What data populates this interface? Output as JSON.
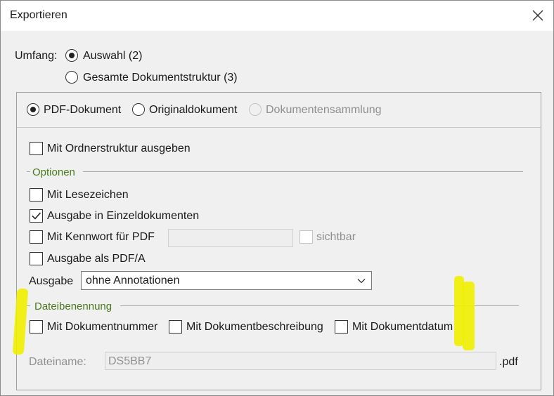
{
  "window": {
    "title": "Exportieren",
    "close_icon": "close-icon"
  },
  "scope": {
    "label": "Umfang:",
    "options": [
      {
        "label": "Auswahl (2)",
        "checked": true
      },
      {
        "label": "Gesamte Dokumentstruktur (3)",
        "checked": false
      }
    ]
  },
  "format": {
    "options": [
      {
        "label": "PDF-Dokument",
        "checked": true,
        "enabled": true
      },
      {
        "label": "Originaldokument",
        "checked": false,
        "enabled": true
      },
      {
        "label": "Dokumentensammlung",
        "checked": false,
        "enabled": false
      }
    ]
  },
  "folder_structure": {
    "label": "Mit Ordnerstruktur ausgeben",
    "checked": false
  },
  "options_section": {
    "title": "Optionen",
    "bookmarks": {
      "label": "Mit Lesezeichen",
      "checked": false
    },
    "single_docs": {
      "label": "Ausgabe in Einzeldokumenten",
      "checked": true
    },
    "password": {
      "label": "Mit Kennwort für PDF",
      "checked": false,
      "value": ""
    },
    "visible": {
      "label": "sichtbar",
      "checked": false,
      "enabled": false
    },
    "pdfa": {
      "label": "Ausgabe als PDF/A",
      "checked": false
    },
    "output": {
      "label": "Ausgabe",
      "selected": "ohne Annotationen"
    }
  },
  "naming_section": {
    "title": "Dateibenennung",
    "doc_number": {
      "label": "Mit Dokumentnummer",
      "checked": false
    },
    "doc_description": {
      "label": "Mit Dokumentbeschreibung",
      "checked": false
    },
    "doc_date": {
      "label": "Mit Dokumentdatum",
      "checked": false
    },
    "filename": {
      "label": "Dateiname:",
      "value": "DS5BB7",
      "extension": ".pdf"
    }
  },
  "colors": {
    "highlight": "#f0f000",
    "section_title": "#4a7a1e",
    "background": "#f0f0f0"
  }
}
